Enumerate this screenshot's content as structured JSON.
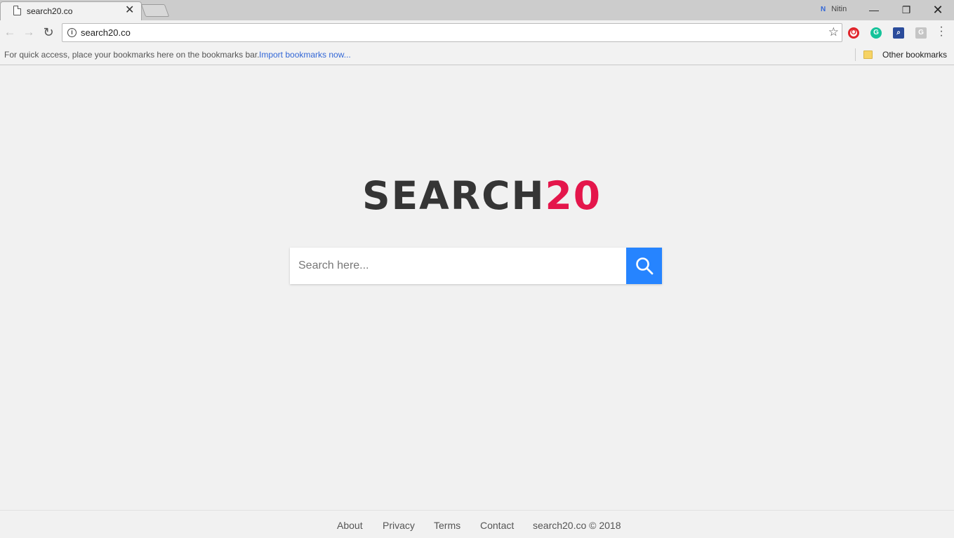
{
  "browser": {
    "tab_title": "search20.co",
    "profile_name": "Nitin",
    "profile_icon_glyph": "N",
    "url": "search20.co",
    "extensions": [
      {
        "name": "opera-extension-icon",
        "glyph": "O",
        "color": "#e0242a"
      },
      {
        "name": "grammarly-extension-icon",
        "glyph": "G",
        "color": "#15c39a"
      },
      {
        "name": "search-extension-icon",
        "glyph": "⌕",
        "color": "#2b4c9b"
      },
      {
        "name": "google-extension-icon",
        "glyph": "G",
        "color": "#c5c5c5"
      }
    ]
  },
  "bookmarks_bar": {
    "hint": "For quick access, place your bookmarks here on the bookmarks bar.",
    "import_link": "Import bookmarks now...",
    "other_bookmarks": "Other bookmarks"
  },
  "page": {
    "logo_main": "SEARCH",
    "logo_accent": "20",
    "search_placeholder": "Search here...",
    "colors": {
      "accent": "#e4164b",
      "button": "#2684ff",
      "logo_text": "#353535"
    }
  },
  "footer": {
    "about": "About",
    "privacy": "Privacy",
    "terms": "Terms",
    "contact": "Contact",
    "copyright": "search20.co © 2018"
  }
}
